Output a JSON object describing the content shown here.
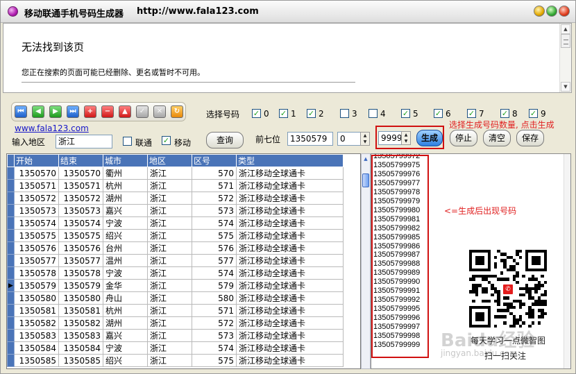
{
  "window": {
    "title": "移动联通手机号码生成器",
    "url": "http://www.fala123.com"
  },
  "browser": {
    "title": "无法找到该页",
    "message": "您正在搜索的页面可能已经删除、更名或暂时不可用。"
  },
  "toolbar": {
    "buttons": [
      {
        "icon": "first-record-icon",
        "glyph": "⏮"
      },
      {
        "icon": "prev-record-icon",
        "glyph": "◀"
      },
      {
        "icon": "next-record-icon",
        "glyph": "▶"
      },
      {
        "icon": "last-record-icon",
        "glyph": "⏭"
      },
      {
        "icon": "insert-record-icon",
        "glyph": "+"
      },
      {
        "icon": "delete-record-icon",
        "glyph": "−"
      },
      {
        "icon": "edit-record-icon",
        "glyph": "▲"
      },
      {
        "icon": "post-record-icon",
        "glyph": "✓"
      },
      {
        "icon": "cancel-record-icon",
        "glyph": "✕"
      },
      {
        "icon": "refresh-record-icon",
        "glyph": "↻"
      }
    ]
  },
  "link": "www.fala123.com",
  "select_numbers": {
    "label": "选择号码",
    "digits": [
      {
        "label": "0",
        "checked": true
      },
      {
        "label": "1",
        "checked": true
      },
      {
        "label": "2",
        "checked": true
      },
      {
        "label": "3",
        "checked": false
      },
      {
        "label": "4",
        "checked": false
      },
      {
        "label": "5",
        "checked": true
      },
      {
        "label": "6",
        "checked": true
      },
      {
        "label": "7",
        "checked": true
      },
      {
        "label": "8",
        "checked": true
      },
      {
        "label": "9",
        "checked": true
      }
    ]
  },
  "region": {
    "label": "输入地区",
    "value": "浙江"
  },
  "carriers": {
    "unicom": {
      "label": "联通",
      "checked": false
    },
    "mobile": {
      "label": "移动",
      "checked": true
    }
  },
  "query_button": "查询",
  "prefix": {
    "label": "前七位",
    "value": "1350579",
    "start": "0",
    "count": "9999"
  },
  "buttons": {
    "generate": "生成",
    "stop": "停止",
    "clear": "清空",
    "save": "保存"
  },
  "annotations": {
    "top": "选择生成号码数量, 点击生成",
    "list": "<=生成后出现号码"
  },
  "grid": {
    "columns": [
      "开始",
      "结束",
      "城市",
      "地区",
      "区号",
      "类型"
    ],
    "rows": [
      [
        "1350570",
        "1350570",
        "衢州",
        "浙江",
        "570",
        "浙江移动全球通卡"
      ],
      [
        "1350571",
        "1350571",
        "杭州",
        "浙江",
        "571",
        "浙江移动全球通卡"
      ],
      [
        "1350572",
        "1350572",
        "湖州",
        "浙江",
        "572",
        "浙江移动全球通卡"
      ],
      [
        "1350573",
        "1350573",
        "嘉兴",
        "浙江",
        "573",
        "浙江移动全球通卡"
      ],
      [
        "1350574",
        "1350574",
        "宁波",
        "浙江",
        "574",
        "浙江移动全球通卡"
      ],
      [
        "1350575",
        "1350575",
        "绍兴",
        "浙江",
        "575",
        "浙江移动全球通卡"
      ],
      [
        "1350576",
        "1350576",
        "台州",
        "浙江",
        "576",
        "浙江移动全球通卡"
      ],
      [
        "1350577",
        "1350577",
        "温州",
        "浙江",
        "577",
        "浙江移动全球通卡"
      ],
      [
        "1350578",
        "1350578",
        "宁波",
        "浙江",
        "574",
        "浙江移动全球通卡"
      ],
      [
        "1350579",
        "1350579",
        "金华",
        "浙江",
        "579",
        "浙江移动全球通卡"
      ],
      [
        "1350580",
        "1350580",
        "舟山",
        "浙江",
        "580",
        "浙江移动全球通卡"
      ],
      [
        "1350581",
        "1350581",
        "杭州",
        "浙江",
        "571",
        "浙江移动全球通卡"
      ],
      [
        "1350582",
        "1350582",
        "湖州",
        "浙江",
        "572",
        "浙江移动全球通卡"
      ],
      [
        "1350583",
        "1350583",
        "嘉兴",
        "浙江",
        "573",
        "浙江移动全球通卡"
      ],
      [
        "1350584",
        "1350584",
        "宁波",
        "浙江",
        "574",
        "浙江移动全球通卡"
      ],
      [
        "1350585",
        "1350585",
        "绍兴",
        "浙江",
        "575",
        "浙江移动全球通卡"
      ]
    ],
    "current_row": 9
  },
  "generated_numbers": [
    "13505799972",
    "13505799975",
    "13505799976",
    "13505799977",
    "13505799978",
    "13505799979",
    "13505799980",
    "13505799981",
    "13505799982",
    "13505799985",
    "13505799986",
    "13505799987",
    "13505799988",
    "13505799989",
    "13505799990",
    "13505799991",
    "13505799992",
    "13505799995",
    "13505799996",
    "13505799997",
    "13505799998",
    "13505799999"
  ],
  "qr_captions": {
    "line1": "每天学习一点微智图",
    "line2": "扫一扫关注"
  },
  "watermark": {
    "text": "Baidu经验",
    "url": "jingyan.baidu.com"
  }
}
